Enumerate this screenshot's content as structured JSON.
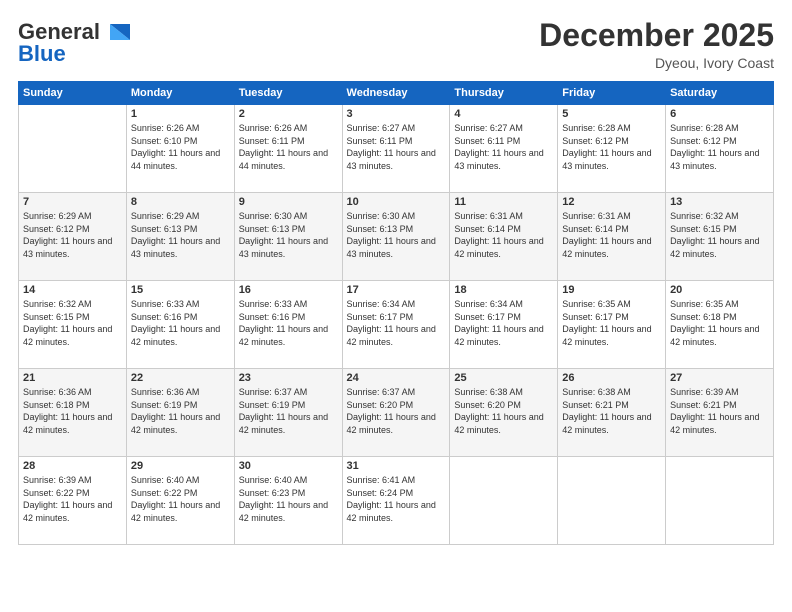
{
  "logo": {
    "general": "General",
    "blue": "Blue"
  },
  "title": "December 2025",
  "location": "Dyeou, Ivory Coast",
  "days_of_week": [
    "Sunday",
    "Monday",
    "Tuesday",
    "Wednesday",
    "Thursday",
    "Friday",
    "Saturday"
  ],
  "weeks": [
    [
      {
        "day": "",
        "sunrise": "",
        "sunset": "",
        "daylight": ""
      },
      {
        "day": "1",
        "sunrise": "Sunrise: 6:26 AM",
        "sunset": "Sunset: 6:10 PM",
        "daylight": "Daylight: 11 hours and 44 minutes."
      },
      {
        "day": "2",
        "sunrise": "Sunrise: 6:26 AM",
        "sunset": "Sunset: 6:11 PM",
        "daylight": "Daylight: 11 hours and 44 minutes."
      },
      {
        "day": "3",
        "sunrise": "Sunrise: 6:27 AM",
        "sunset": "Sunset: 6:11 PM",
        "daylight": "Daylight: 11 hours and 43 minutes."
      },
      {
        "day": "4",
        "sunrise": "Sunrise: 6:27 AM",
        "sunset": "Sunset: 6:11 PM",
        "daylight": "Daylight: 11 hours and 43 minutes."
      },
      {
        "day": "5",
        "sunrise": "Sunrise: 6:28 AM",
        "sunset": "Sunset: 6:12 PM",
        "daylight": "Daylight: 11 hours and 43 minutes."
      },
      {
        "day": "6",
        "sunrise": "Sunrise: 6:28 AM",
        "sunset": "Sunset: 6:12 PM",
        "daylight": "Daylight: 11 hours and 43 minutes."
      }
    ],
    [
      {
        "day": "7",
        "sunrise": "Sunrise: 6:29 AM",
        "sunset": "Sunset: 6:12 PM",
        "daylight": "Daylight: 11 hours and 43 minutes."
      },
      {
        "day": "8",
        "sunrise": "Sunrise: 6:29 AM",
        "sunset": "Sunset: 6:13 PM",
        "daylight": "Daylight: 11 hours and 43 minutes."
      },
      {
        "day": "9",
        "sunrise": "Sunrise: 6:30 AM",
        "sunset": "Sunset: 6:13 PM",
        "daylight": "Daylight: 11 hours and 43 minutes."
      },
      {
        "day": "10",
        "sunrise": "Sunrise: 6:30 AM",
        "sunset": "Sunset: 6:13 PM",
        "daylight": "Daylight: 11 hours and 43 minutes."
      },
      {
        "day": "11",
        "sunrise": "Sunrise: 6:31 AM",
        "sunset": "Sunset: 6:14 PM",
        "daylight": "Daylight: 11 hours and 42 minutes."
      },
      {
        "day": "12",
        "sunrise": "Sunrise: 6:31 AM",
        "sunset": "Sunset: 6:14 PM",
        "daylight": "Daylight: 11 hours and 42 minutes."
      },
      {
        "day": "13",
        "sunrise": "Sunrise: 6:32 AM",
        "sunset": "Sunset: 6:15 PM",
        "daylight": "Daylight: 11 hours and 42 minutes."
      }
    ],
    [
      {
        "day": "14",
        "sunrise": "Sunrise: 6:32 AM",
        "sunset": "Sunset: 6:15 PM",
        "daylight": "Daylight: 11 hours and 42 minutes."
      },
      {
        "day": "15",
        "sunrise": "Sunrise: 6:33 AM",
        "sunset": "Sunset: 6:16 PM",
        "daylight": "Daylight: 11 hours and 42 minutes."
      },
      {
        "day": "16",
        "sunrise": "Sunrise: 6:33 AM",
        "sunset": "Sunset: 6:16 PM",
        "daylight": "Daylight: 11 hours and 42 minutes."
      },
      {
        "day": "17",
        "sunrise": "Sunrise: 6:34 AM",
        "sunset": "Sunset: 6:17 PM",
        "daylight": "Daylight: 11 hours and 42 minutes."
      },
      {
        "day": "18",
        "sunrise": "Sunrise: 6:34 AM",
        "sunset": "Sunset: 6:17 PM",
        "daylight": "Daylight: 11 hours and 42 minutes."
      },
      {
        "day": "19",
        "sunrise": "Sunrise: 6:35 AM",
        "sunset": "Sunset: 6:17 PM",
        "daylight": "Daylight: 11 hours and 42 minutes."
      },
      {
        "day": "20",
        "sunrise": "Sunrise: 6:35 AM",
        "sunset": "Sunset: 6:18 PM",
        "daylight": "Daylight: 11 hours and 42 minutes."
      }
    ],
    [
      {
        "day": "21",
        "sunrise": "Sunrise: 6:36 AM",
        "sunset": "Sunset: 6:18 PM",
        "daylight": "Daylight: 11 hours and 42 minutes."
      },
      {
        "day": "22",
        "sunrise": "Sunrise: 6:36 AM",
        "sunset": "Sunset: 6:19 PM",
        "daylight": "Daylight: 11 hours and 42 minutes."
      },
      {
        "day": "23",
        "sunrise": "Sunrise: 6:37 AM",
        "sunset": "Sunset: 6:19 PM",
        "daylight": "Daylight: 11 hours and 42 minutes."
      },
      {
        "day": "24",
        "sunrise": "Sunrise: 6:37 AM",
        "sunset": "Sunset: 6:20 PM",
        "daylight": "Daylight: 11 hours and 42 minutes."
      },
      {
        "day": "25",
        "sunrise": "Sunrise: 6:38 AM",
        "sunset": "Sunset: 6:20 PM",
        "daylight": "Daylight: 11 hours and 42 minutes."
      },
      {
        "day": "26",
        "sunrise": "Sunrise: 6:38 AM",
        "sunset": "Sunset: 6:21 PM",
        "daylight": "Daylight: 11 hours and 42 minutes."
      },
      {
        "day": "27",
        "sunrise": "Sunrise: 6:39 AM",
        "sunset": "Sunset: 6:21 PM",
        "daylight": "Daylight: 11 hours and 42 minutes."
      }
    ],
    [
      {
        "day": "28",
        "sunrise": "Sunrise: 6:39 AM",
        "sunset": "Sunset: 6:22 PM",
        "daylight": "Daylight: 11 hours and 42 minutes."
      },
      {
        "day": "29",
        "sunrise": "Sunrise: 6:40 AM",
        "sunset": "Sunset: 6:22 PM",
        "daylight": "Daylight: 11 hours and 42 minutes."
      },
      {
        "day": "30",
        "sunrise": "Sunrise: 6:40 AM",
        "sunset": "Sunset: 6:23 PM",
        "daylight": "Daylight: 11 hours and 42 minutes."
      },
      {
        "day": "31",
        "sunrise": "Sunrise: 6:41 AM",
        "sunset": "Sunset: 6:24 PM",
        "daylight": "Daylight: 11 hours and 42 minutes."
      },
      {
        "day": "",
        "sunrise": "",
        "sunset": "",
        "daylight": ""
      },
      {
        "day": "",
        "sunrise": "",
        "sunset": "",
        "daylight": ""
      },
      {
        "day": "",
        "sunrise": "",
        "sunset": "",
        "daylight": ""
      }
    ]
  ]
}
